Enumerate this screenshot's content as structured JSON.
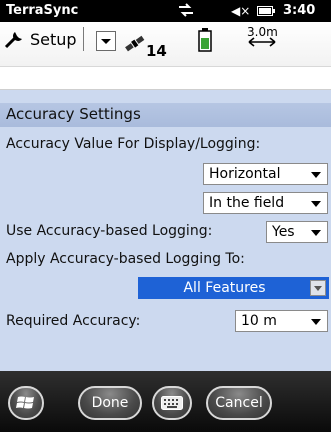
{
  "statusbar": {
    "app_title": "TerraSync",
    "time": "3:40"
  },
  "toolbar": {
    "setup_label": "Setup",
    "satellite_count": "14",
    "accuracy_value": "3.0m"
  },
  "section": {
    "title": "Accuracy Settings"
  },
  "fields": {
    "accuracy_value_label": "Accuracy Value For Display/Logging:",
    "accuracy_type_value": "Horizontal",
    "accuracy_when_value": "In the field",
    "use_logging_label": "Use Accuracy-based Logging:",
    "use_logging_value": "Yes",
    "apply_to_label": "Apply Accuracy-based Logging To:",
    "apply_to_value": "All Features",
    "required_accuracy_label": "Required Accuracy:",
    "required_accuracy_value": "10 m"
  },
  "softkeys": {
    "done_label": "Done",
    "cancel_label": "Cancel"
  },
  "colors": {
    "content_bg": "#ccd9ef",
    "header_bg": "#b0c2e1",
    "selection": "#1e62d6"
  },
  "icons": [
    "sync-icon",
    "volume-muted-icon",
    "battery-icon",
    "wrench-icon",
    "satellite-icon",
    "power-icon",
    "accuracy-arrow-icon",
    "windows-start-icon",
    "keyboard-icon"
  ]
}
